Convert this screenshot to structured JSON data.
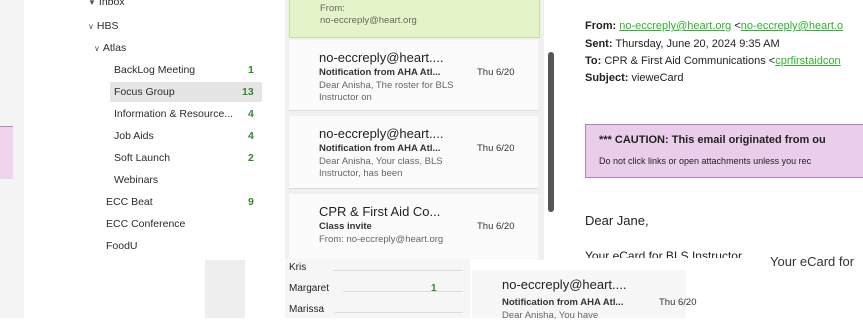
{
  "folders": {
    "inbox_label": "Inbox",
    "items": [
      {
        "label": "HBS",
        "count": ""
      },
      {
        "label": "Atlas",
        "count": ""
      },
      {
        "label": "BackLog Meeting",
        "count": "1"
      },
      {
        "label": "Focus Group",
        "count": "13"
      },
      {
        "label": "Information & Resource...",
        "count": "4"
      },
      {
        "label": "Job Aids",
        "count": "4"
      },
      {
        "label": "Soft Launch",
        "count": "2"
      },
      {
        "label": "Webinars",
        "count": ""
      },
      {
        "label": "ECC Beat",
        "count": "9"
      },
      {
        "label": "ECC Conference",
        "count": ""
      },
      {
        "label": "FoodU",
        "count": ""
      }
    ]
  },
  "messages": {
    "top_partial": {
      "from_label": "From:",
      "from_value": "no-eccreply@heart.org"
    },
    "items": [
      {
        "sender": "no-eccreply@heart....",
        "subject": "Notification from AHA Atl...",
        "date": "Thu 6/20",
        "preview": "Dear Anisha, The roster for BLS Instructor on"
      },
      {
        "sender": "no-eccreply@heart....",
        "subject": "Notification from AHA Atl...",
        "date": "Thu 6/20",
        "preview": "Dear Anisha, Your class, BLS Instructor, has been"
      },
      {
        "sender": "CPR & First Aid Co...",
        "subject": "Class invite",
        "date": "Thu 6/20",
        "preview": "From: no-eccreply@heart.org"
      }
    ]
  },
  "email": {
    "from_label": "From:",
    "from_link1": "no-eccreply@heart.org",
    "from_link2_prefix": "<",
    "from_link2": "no-eccreply@heart.o",
    "sent_label": "Sent:",
    "sent_value": "Thursday, June 20, 2024 9:35 AM",
    "to_label": "To:",
    "to_value": "CPR & First Aid Communications <",
    "to_link": "cprfirstaidcon",
    "subject_label": "Subject:",
    "subject_value": "vieweCard",
    "caution_title": "*** CAUTION: This email originated from ou",
    "caution_body": "Do not click links or open attachments unless you rec",
    "greeting": "Dear Jane,",
    "body_cut": "Your eCard for BLS Instructor ......"
  },
  "bottom": {
    "folder_rows": [
      {
        "label": "Kris",
        "count": ""
      },
      {
        "label": "Margaret",
        "count": "1"
      },
      {
        "label": "Marissa",
        "count": ""
      }
    ],
    "card": {
      "sender": "no-eccreply@heart....",
      "subject": "Notification from AHA Atl...",
      "date": "Thu 6/20",
      "preview": "Dear Anisha, You have"
    },
    "scribble": "Your eCard for"
  }
}
